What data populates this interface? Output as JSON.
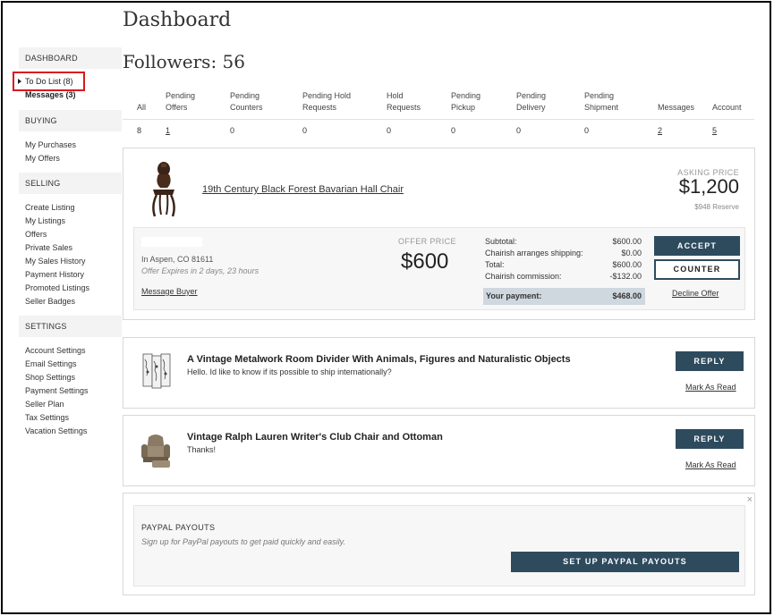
{
  "page_title": "Dashboard",
  "followers": "Followers: 56",
  "sidebar": {
    "dashboard_header": "DASHBOARD",
    "todo": "To Do List (8)",
    "messages": "Messages (3)",
    "buying_header": "BUYING",
    "buying": [
      "My Purchases",
      "My Offers"
    ],
    "selling_header": "SELLING",
    "selling": [
      "Create Listing",
      "My Listings",
      "Offers",
      "Private Sales",
      "My Sales History",
      "Payment History",
      "Promoted Listings",
      "Seller Badges"
    ],
    "settings_header": "SETTINGS",
    "settings": [
      "Account Settings",
      "Email Settings",
      "Shop Settings",
      "Payment Settings",
      "Seller Plan",
      "Tax Settings",
      "Vacation Settings"
    ]
  },
  "stats": {
    "headers": [
      "All",
      "Pending\nOffers",
      "Pending\nCounters",
      "Pending Hold\nRequests",
      "Hold\nRequests",
      "Pending\nPickup",
      "Pending\nDelivery",
      "Pending\nShipment",
      "Messages",
      "Account"
    ],
    "values": [
      "8",
      "1",
      "0",
      "0",
      "0",
      "0",
      "0",
      "0",
      "2",
      "5"
    ]
  },
  "offer": {
    "title": "19th Century Black Forest Bavarian Hall Chair",
    "asking_label": "ASKING PRICE",
    "asking_price": "$1,200",
    "reserve": "$948 Reserve",
    "location": "In Aspen, CO 81611",
    "expires": "Offer Expires in 2 days, 23 hours",
    "message_buyer": "Message Buyer",
    "offer_label": "OFFER PRICE",
    "offer_price": "$600",
    "summary": {
      "subtotal_label": "Subtotal:",
      "subtotal": "$600.00",
      "shipping_label": "Chairish arranges shipping:",
      "shipping": "$0.00",
      "total_label": "Total:",
      "total": "$600.00",
      "commission_label": "Chairish commission:",
      "commission": "-$132.00",
      "payment_label": "Your payment:",
      "payment": "$468.00"
    },
    "accept": "ACCEPT",
    "counter": "COUNTER",
    "decline": "Decline Offer"
  },
  "messages": [
    {
      "title": "A Vintage Metalwork Room Divider With Animals, Figures and Naturalistic Objects",
      "text": "Hello. Id like to know if its possible to ship internationally?",
      "reply": "REPLY",
      "mark_read": "Mark As Read"
    },
    {
      "title": "Vintage Ralph Lauren Writer's Club Chair and Ottoman",
      "text": "Thanks!",
      "reply": "REPLY",
      "mark_read": "Mark As Read"
    }
  ],
  "paypal": {
    "close": "×",
    "title": "PAYPAL PAYOUTS",
    "subtitle": "Sign up for PayPal payouts to get paid quickly and easily.",
    "button": "SET UP PAYPAL PAYOUTS"
  },
  "colors": {
    "accent": "#2e4b5e",
    "highlight_box": "#d9181e",
    "payment_bg": "#cfd8df"
  }
}
